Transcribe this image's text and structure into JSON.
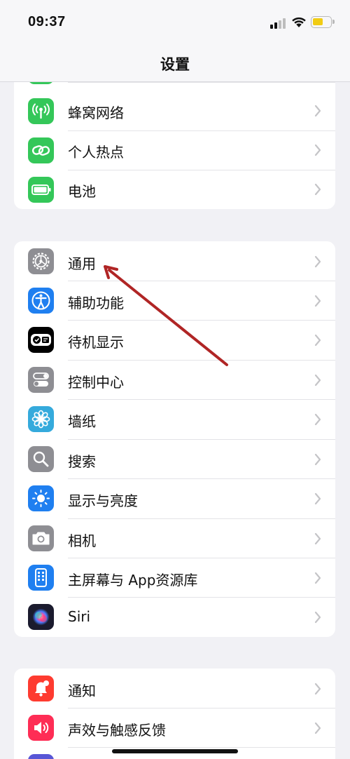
{
  "status_bar": {
    "time": "09:37",
    "battery_color": "#f1cc14"
  },
  "nav": {
    "title": "设置"
  },
  "groups": [
    {
      "items": [
        {
          "label": "蜂窝网络",
          "icon": "antenna-icon",
          "color": "#34c759"
        },
        {
          "label": "个人热点",
          "icon": "chain-link-icon",
          "color": "#34c759"
        },
        {
          "label": "电池",
          "icon": "battery-icon",
          "color": "#34c759"
        }
      ]
    },
    {
      "items": [
        {
          "label": "通用",
          "icon": "gear-icon",
          "color": "#8e8e93"
        },
        {
          "label": "辅助功能",
          "icon": "accessibility-person-icon",
          "color": "#1f7ff0"
        },
        {
          "label": "待机显示",
          "icon": "standby-icon",
          "color": "#000000"
        },
        {
          "label": "控制中心",
          "icon": "toggles-icon",
          "color": "#8e8e93"
        },
        {
          "label": "墙纸",
          "icon": "flower-icon",
          "color": "#35aadc"
        },
        {
          "label": "搜索",
          "icon": "magnifier-icon",
          "color": "#8e8e93"
        },
        {
          "label": "显示与亮度",
          "icon": "sun-icon",
          "color": "#1f7ff0"
        },
        {
          "label": "相机",
          "icon": "camera-icon",
          "color": "#8e8e93"
        },
        {
          "label": "主屏幕与 App资源库",
          "icon": "home-screen-icon",
          "color": "#1f7ff0"
        },
        {
          "label": "Siri",
          "icon": "siri-icon",
          "color": "#1b1b2e"
        }
      ]
    },
    {
      "items": [
        {
          "label": "通知",
          "icon": "bell-icon",
          "color": "#fe3b30"
        },
        {
          "label": "声效与触感反馈",
          "icon": "speaker-icon",
          "color": "#fe2d55"
        },
        {
          "label": "",
          "icon": "partial-icon",
          "color": "#5856d6"
        }
      ]
    }
  ],
  "annotation_color": "#b02525"
}
